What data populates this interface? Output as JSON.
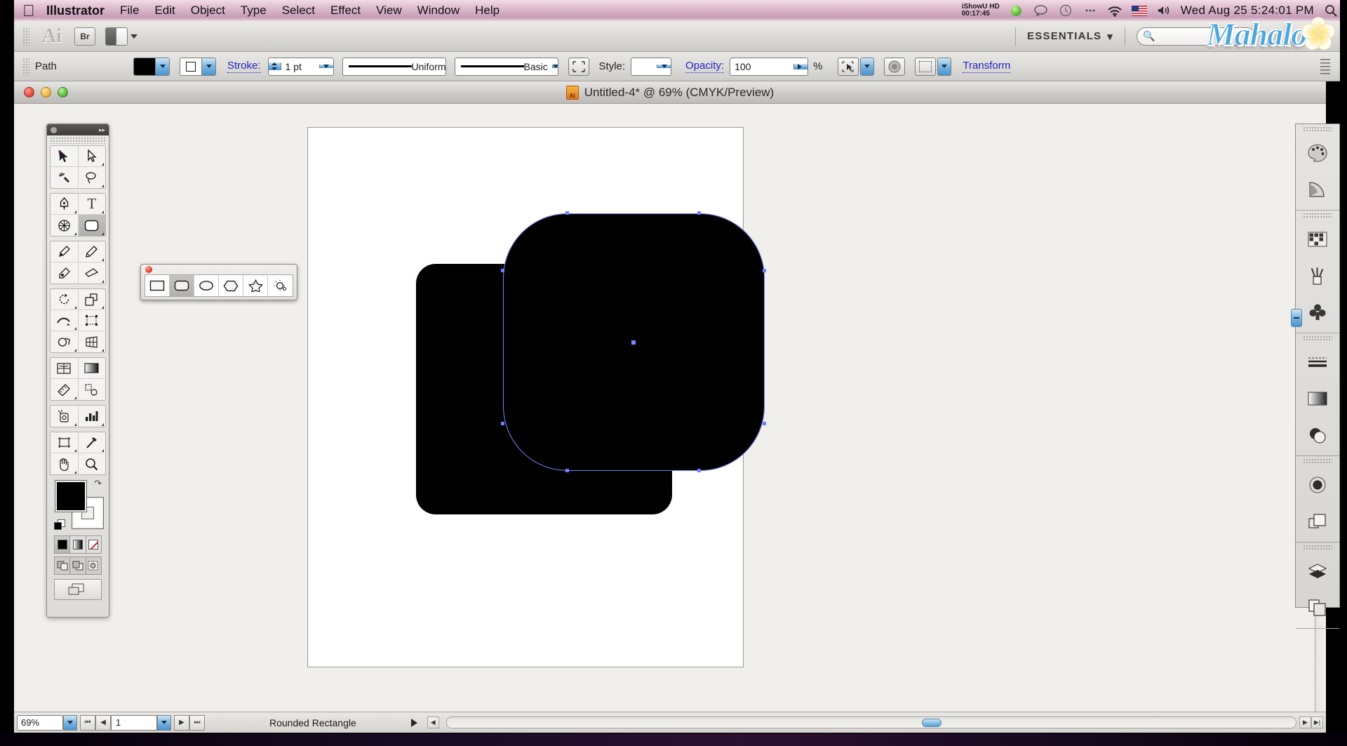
{
  "menubar": {
    "apple_icon": "apple-icon",
    "items": [
      "Illustrator",
      "File",
      "Edit",
      "Object",
      "Type",
      "Select",
      "Effect",
      "View",
      "Window",
      "Help"
    ],
    "status": {
      "ishowu_name": "iShowU HD",
      "ishowu_time": "00:17:45",
      "icons": [
        "record-dot-icon",
        "speech-bubble-icon",
        "time-machine-icon",
        "bluetooth-icon",
        "wifi-icon",
        "flag-icon",
        "volume-icon"
      ],
      "clock": "Wed Aug 25  5:24:01 PM",
      "spotlight_icon": "search-icon"
    }
  },
  "watermark": {
    "text": "Mahalo",
    "flower_icon": "plumeria-flower-icon"
  },
  "appbar": {
    "logo": "Ai",
    "bridge_label": "Br",
    "arrange_icon": "arrange-documents-icon",
    "workspace": "ESSENTIALS",
    "workspace_caret": "▾",
    "search_icon": "search-icon",
    "search_placeholder": ""
  },
  "controlbar": {
    "object_label": "Path",
    "fill_swatch_color": "#000000",
    "stroke_swatch_color": "#ffffff",
    "stroke_label": "Stroke:",
    "stroke_weight": "1 pt",
    "stroke_profile": "Uniform",
    "brush_definition": "Basic",
    "opacity_mask_icon": "opacity-mask-icon",
    "style_label": "Style:",
    "graphic_style": "",
    "opacity_label": "Opacity:",
    "opacity_value": "100",
    "percent_sign": "%",
    "select_similar_icon": "select-similar-icon",
    "isolate_icon": "isolate-group-icon",
    "align_icon": "align-icon",
    "transform_label": "Transform",
    "panel_menu_icon": "panel-menu-icon"
  },
  "document": {
    "traffic_lights": [
      "close-button",
      "minimize-button",
      "zoom-button"
    ],
    "title": "Untitled-4* @ 69% (CMYK/Preview)",
    "file_icon": "illustrator-document-icon"
  },
  "tools": {
    "header_icon": "collapse-panel-icon",
    "groups": [
      [
        [
          "selection-tool",
          "⬉"
        ],
        [
          "direct-selection-tool",
          "⬈"
        ]
      ],
      [
        [
          "magic-wand-tool",
          "✦"
        ],
        [
          "lasso-tool",
          "◌"
        ]
      ],
      [
        [
          "pen-tool",
          "✒"
        ],
        [
          "type-tool",
          "T"
        ]
      ],
      [
        [
          "line-segment-tool",
          "⊕"
        ],
        [
          "rounded-rectangle-tool",
          "▢"
        ]
      ],
      [
        [
          "paintbrush-tool",
          "🖌"
        ],
        [
          "pencil-tool",
          "✎"
        ]
      ],
      [
        [
          "blob-brush-tool",
          "◮"
        ],
        [
          "eraser-tool",
          "▱"
        ]
      ],
      [
        [
          "rotate-tool",
          "↻"
        ],
        [
          "scale-tool",
          "◳"
        ]
      ],
      [
        [
          "width-tool",
          "∿"
        ],
        [
          "free-transform-tool",
          "⬚"
        ]
      ],
      [
        [
          "shape-builder-tool",
          "◍"
        ],
        [
          "perspective-grid-tool",
          "▦"
        ]
      ],
      [
        [
          "mesh-tool",
          "▩"
        ],
        [
          "gradient-tool",
          "▬"
        ]
      ],
      [
        [
          "eyedropper-measure-tool",
          "📏"
        ],
        [
          "blend-tool",
          "◔"
        ]
      ],
      [
        [
          "symbol-sprayer-tool",
          "⚱"
        ],
        [
          "column-graph-tool",
          "▥"
        ]
      ],
      [
        [
          "artboard-tool",
          "⬓"
        ],
        [
          "slice-tool",
          "✂"
        ]
      ],
      [
        [
          "hand-tool",
          "✋"
        ],
        [
          "zoom-tool",
          "🔍"
        ]
      ]
    ],
    "fill_color": "#000000",
    "stroke_color": "#ffffff",
    "swap_icon": "swap-fill-stroke-icon",
    "default_icon": "default-fill-stroke-icon",
    "color_modes": [
      "color-mode-solid",
      "color-mode-gradient",
      "color-mode-none"
    ],
    "draw_modes": [
      "draw-normal",
      "draw-behind",
      "draw-inside"
    ],
    "screen_mode": "change-screen-mode-icon"
  },
  "shape_panel": {
    "close_icon": "close-button",
    "tools": [
      {
        "name": "rectangle-tool",
        "glyph": "▭",
        "selected": false
      },
      {
        "name": "rounded-rectangle-tool",
        "glyph": "▢",
        "selected": true
      },
      {
        "name": "ellipse-tool",
        "glyph": "⬭",
        "selected": false
      },
      {
        "name": "polygon-tool",
        "glyph": "⬡",
        "selected": false
      },
      {
        "name": "star-tool",
        "glyph": "☆",
        "selected": false
      },
      {
        "name": "flare-tool",
        "glyph": "✺",
        "selected": false
      }
    ]
  },
  "dock": {
    "sections": [
      [
        [
          "color-panel-icon",
          "🎨"
        ],
        [
          "color-guide-panel-icon",
          "◥"
        ]
      ],
      [
        [
          "swatches-panel-icon",
          "▦"
        ],
        [
          "brushes-panel-icon",
          "🖌"
        ],
        [
          "symbols-panel-icon",
          "♣"
        ]
      ],
      [
        [
          "stroke-panel-icon",
          "≡"
        ],
        [
          "gradient-panel-icon",
          "▬"
        ],
        [
          "transparency-panel-icon",
          "◓"
        ]
      ],
      [
        [
          "appearance-panel-icon",
          "◉"
        ],
        [
          "graphic-styles-panel-icon",
          "❐"
        ]
      ],
      [
        [
          "layers-panel-icon",
          "◆"
        ],
        [
          "artboards-panel-icon",
          "❏"
        ]
      ]
    ],
    "collapse_icon": "expand-dock-icon"
  },
  "statusbar": {
    "zoom_level": "69%",
    "zoom_caret": "▼",
    "nav_first": "⏮",
    "nav_prev": "◀",
    "page_number": "1",
    "page_caret": "▼",
    "nav_next": "▶",
    "nav_last": "⏭",
    "status_text": "Rounded Rectangle",
    "status_arrow": "▶"
  },
  "artwork": {
    "back_shape": {
      "name": "rounded-rectangle-back",
      "fill": "#000000"
    },
    "front_shape": {
      "name": "rounded-rectangle-front-selected",
      "fill": "#000000"
    },
    "selection_color": "#6f7dff",
    "anchor_count": 8
  }
}
